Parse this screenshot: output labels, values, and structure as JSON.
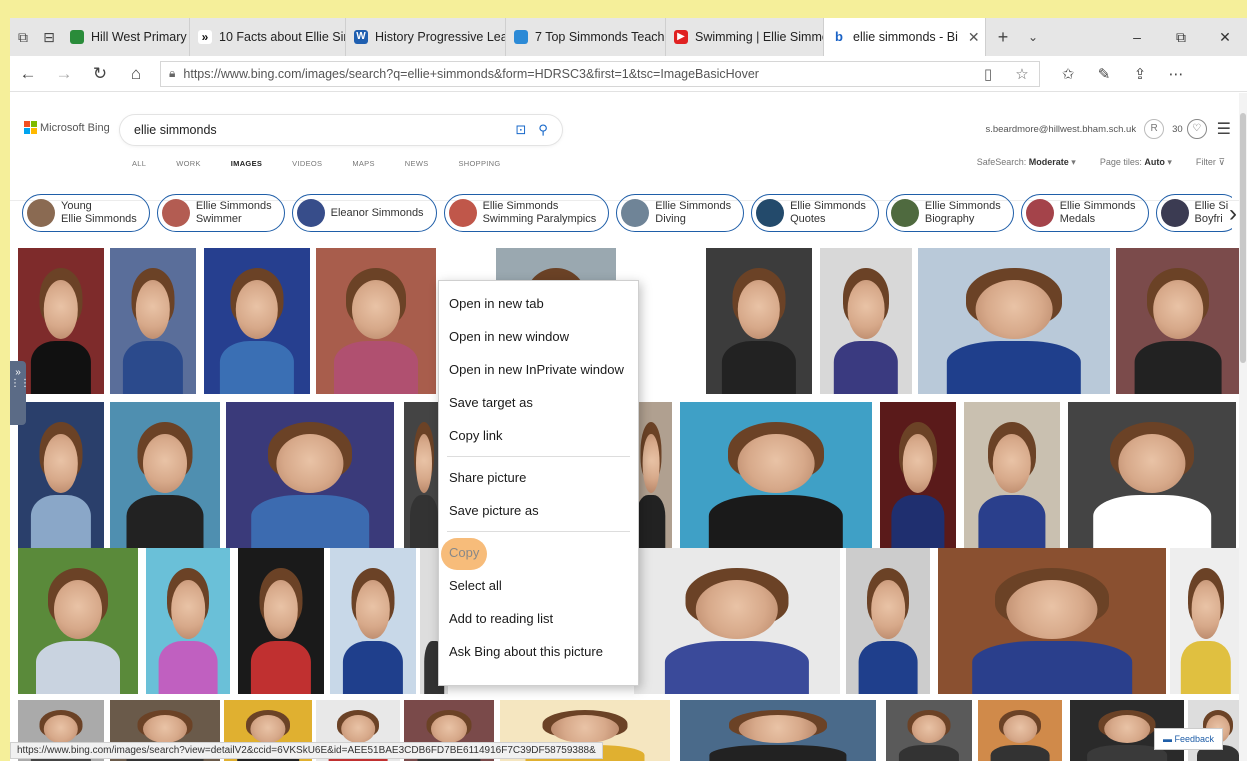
{
  "browser": {
    "tabs": [
      {
        "title": "Hill West Primary - Lea",
        "icon_color": "#2a8c3a"
      },
      {
        "title": "10 Facts about Ellie Sir",
        "icon_color": "#222222"
      },
      {
        "title": "History Progressive Lea",
        "icon_color": "#1f5fb0"
      },
      {
        "title": "7 Top Simmonds Teach",
        "icon_color": "#2c8ad6"
      },
      {
        "title": "Swimming | Ellie Simmo",
        "icon_color": "#e02121"
      },
      {
        "title": "ellie simmonds - Bi",
        "icon_color": "#1b63c6",
        "active": true
      }
    ],
    "url": "https://www.bing.com/images/search?q=ellie+simmonds&form=HDRSC3&first=1&tsc=ImageBasicHover",
    "status_url": "https://www.bing.com/images/search?view=detailV2&ccid=6VKSkU6E&id=AEE51BAE3CDB6FD7BE6114916F7C39DF58759388&"
  },
  "bing": {
    "brand": "Microsoft Bing",
    "query": "ellie simmonds",
    "account_email": "s.beardmore@hillwest.bham.sch.uk",
    "rewards": "30",
    "scopes": [
      "ALL",
      "WORK",
      "IMAGES",
      "VIDEOS",
      "MAPS",
      "NEWS",
      "SHOPPING"
    ],
    "active_scope": "IMAGES",
    "safesearch_label": "SafeSearch:",
    "safesearch_value": "Moderate",
    "pagetiles_label": "Page tiles:",
    "pagetiles_value": "Auto",
    "filter_label": "Filter"
  },
  "related": [
    {
      "line1": "Young",
      "line2": "Ellie Simmonds"
    },
    {
      "line1": "Ellie Simmonds",
      "line2": "Swimmer"
    },
    {
      "line1": "Eleanor Simmonds",
      "line2": ""
    },
    {
      "line1": "Ellie Simmonds",
      "line2": "Swimming Paralympics"
    },
    {
      "line1": "Ellie Simmonds",
      "line2": "Diving"
    },
    {
      "line1": "Ellie Simmonds",
      "line2": "Quotes"
    },
    {
      "line1": "Ellie Simmonds",
      "line2": "Biography"
    },
    {
      "line1": "Ellie Simmonds",
      "line2": "Medals"
    },
    {
      "line1": "Ellie Si",
      "line2": "Boyfri"
    }
  ],
  "context_menu": {
    "items": [
      "Open in new tab",
      "Open in new window",
      "Open in new InPrivate window",
      "Save target as",
      "Copy link",
      "Share picture",
      "Save picture as",
      "Copy",
      "Select all",
      "Add to reading list",
      "Ask Bing about this picture"
    ],
    "highlighted": "Copy"
  },
  "feedback_label": "Feedback"
}
